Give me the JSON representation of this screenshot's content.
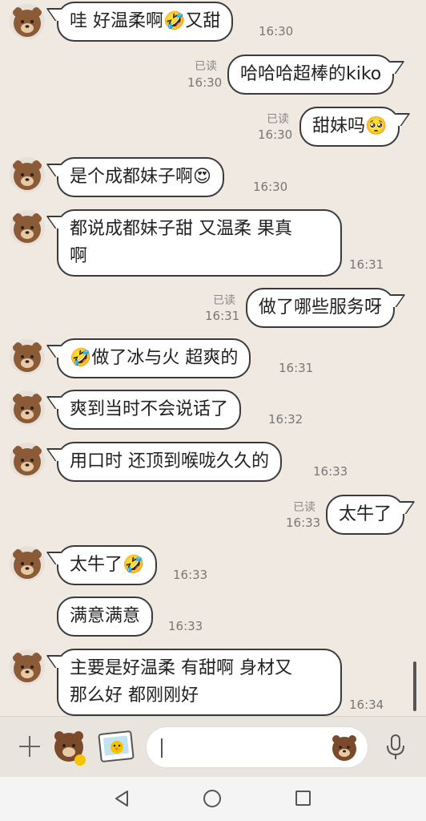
{
  "messages": [
    {
      "side": "left",
      "text": "哇 好温柔啊🤣又甜",
      "time": "16:30"
    },
    {
      "side": "right",
      "text": "哈哈哈超棒的kiko",
      "time": "16:30",
      "read": "已读"
    },
    {
      "side": "right",
      "text": "甜妹吗🥺",
      "time": "16:30",
      "read": "已读"
    },
    {
      "side": "left",
      "text": "是个成都妹子啊😍",
      "time": "16:30"
    },
    {
      "side": "left",
      "text": "都说成都妹子甜 又温柔 果真\n啊",
      "time": "16:31"
    },
    {
      "side": "right",
      "text": "做了哪些服务呀",
      "time": "16:31",
      "read": "已读"
    },
    {
      "side": "left",
      "text": "🤣做了冰与火 超爽的",
      "time": "16:31"
    },
    {
      "side": "left",
      "text": "爽到当时不会说话了",
      "time": "16:32"
    },
    {
      "side": "left",
      "text": "用口时 还顶到喉咙久久的",
      "time": "16:33"
    },
    {
      "side": "right",
      "text": "太牛了",
      "time": "16:33",
      "read": "已读"
    },
    {
      "side": "left",
      "text": "太牛了🤣",
      "time": "16:33"
    },
    {
      "side": "left",
      "text": "满意满意",
      "time": "16:33"
    },
    {
      "side": "left",
      "text": "主要是好温柔 有甜啊 身材又\n那么好 都刚刚好",
      "time": "16:34"
    }
  ],
  "input": {
    "placeholder": ""
  },
  "icons": {
    "plus": "plus-icon",
    "sticker": "bear-sticker-icon",
    "photo": "photo-icon",
    "emoji": "bear-emoji-icon",
    "mic": "microphone-icon",
    "back": "back-triangle-icon",
    "home": "home-circle-icon",
    "recent": "recent-square-icon"
  },
  "colors": {
    "background": "#efe9e1",
    "bubble": "#ffffff",
    "border": "#3a3a3a"
  }
}
